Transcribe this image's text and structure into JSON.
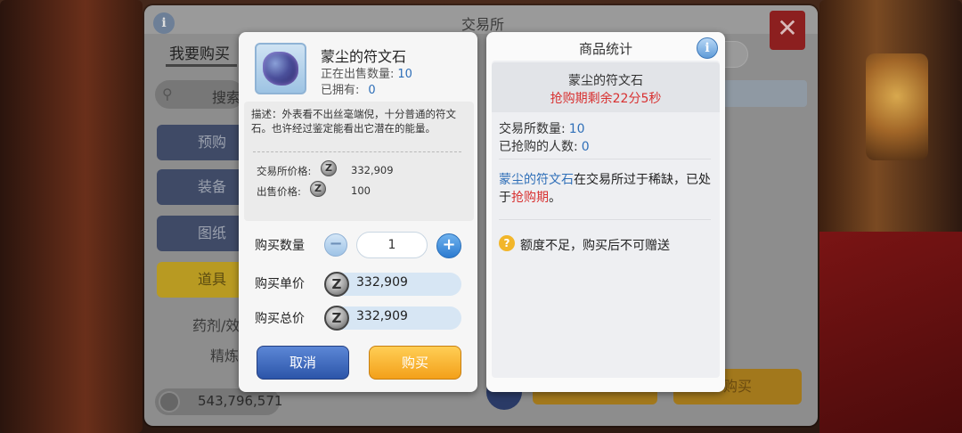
{
  "background": {
    "window_title": "交易所",
    "tab_buy": "我要购买",
    "search_label": "搜索",
    "categories": [
      "预购",
      "装备",
      "图纸",
      "道具"
    ],
    "subcategories": [
      "药剂/效",
      "精炼"
    ],
    "money": "543,796,571",
    "right_button_label": "购买",
    "close_symbol": "✕",
    "info_symbol": "i"
  },
  "dialog": {
    "item_name": "蒙尘的符文石",
    "on_sale_label": "正在出售数量:",
    "on_sale_value": "10",
    "owned_label": "已拥有:",
    "owned_value": "0",
    "description": "描述：外表看不出丝毫端倪，十分普通的符文石。也许经过鉴定能看出它潜在的能量。",
    "exchange_price_label": "交易所价格:",
    "exchange_price_value": "332,909",
    "sell_price_label": "出售价格:",
    "sell_price_value": "100",
    "quantity_label": "购买数量",
    "quantity_value": "1",
    "minus_symbol": "−",
    "plus_symbol": "+",
    "unit_price_label": "购买单价",
    "unit_price_value": "332,909",
    "total_price_label": "购买总价",
    "total_price_value": "332,909",
    "coin_symbol": "Z",
    "cancel_label": "取消",
    "buy_label": "购买"
  },
  "stats": {
    "title": "商品统计",
    "info_symbol": "i",
    "item_name": "蒙尘的符文石",
    "countdown": "抢购期剩余22分5秒",
    "exchange_count_label": "交易所数量:",
    "exchange_count_value": "10",
    "rushed_label": "已抢购的人数:",
    "rushed_value": "0",
    "scarce_item": "蒙尘的符文石",
    "scarce_text_1": "在交易所过于稀缺，已处于",
    "scarce_highlight": "抢购期",
    "scarce_text_2": "。",
    "warning_symbol": "?",
    "warning_text": "额度不足，购买后不可赠送"
  },
  "colors": {
    "accent_blue": "#2f6fb8",
    "alert_red": "#d83030",
    "buy_gold": "#f3a01a",
    "cancel_blue": "#2c55a9"
  }
}
